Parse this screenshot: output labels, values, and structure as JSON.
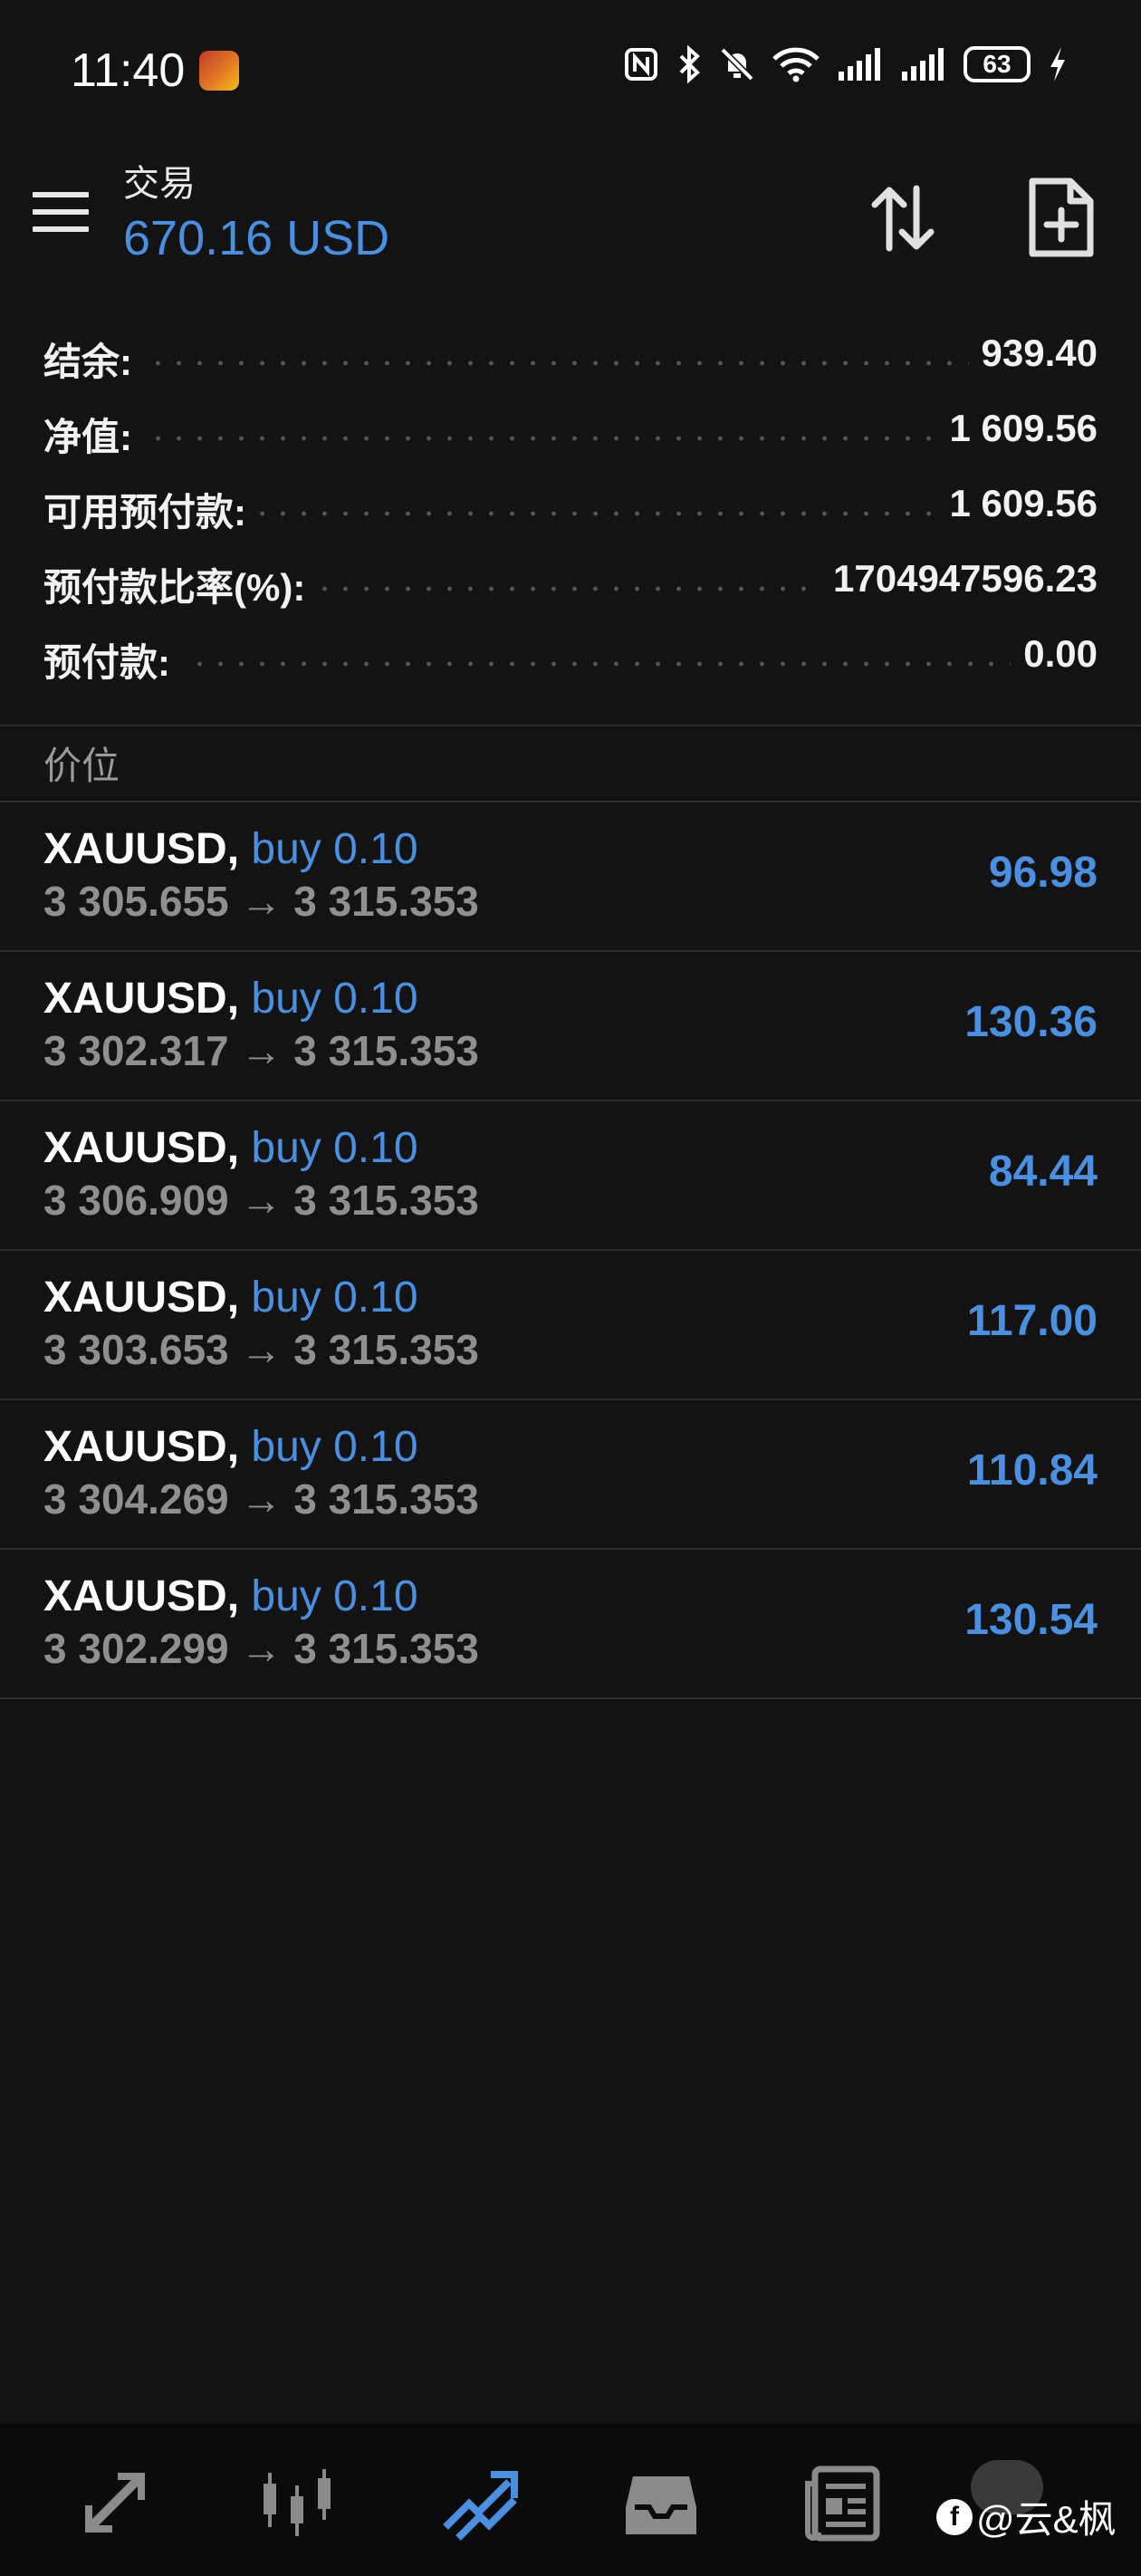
{
  "status_bar": {
    "time": "11:40",
    "battery": "63"
  },
  "header": {
    "title": "交易",
    "balance_display": "670.16 USD"
  },
  "summary": [
    {
      "label": "结余:",
      "value": "939.40"
    },
    {
      "label": "净值:",
      "value": "1 609.56"
    },
    {
      "label": "可用预付款:",
      "value": "1 609.56"
    },
    {
      "label": "预付款比率(%):",
      "value": "1704947596.23"
    },
    {
      "label": "预付款:",
      "value": "0.00"
    }
  ],
  "section_title": "价位",
  "positions": [
    {
      "symbol": "XAUUSD,",
      "side": "buy 0.10",
      "open": "3 305.655",
      "arrow": "→",
      "current": "3 315.353",
      "profit": "96.98"
    },
    {
      "symbol": "XAUUSD,",
      "side": "buy 0.10",
      "open": "3 302.317",
      "arrow": "→",
      "current": "3 315.353",
      "profit": "130.36"
    },
    {
      "symbol": "XAUUSD,",
      "side": "buy 0.10",
      "open": "3 306.909",
      "arrow": "→",
      "current": "3 315.353",
      "profit": "84.44"
    },
    {
      "symbol": "XAUUSD,",
      "side": "buy 0.10",
      "open": "3 303.653",
      "arrow": "→",
      "current": "3 315.353",
      "profit": "117.00"
    },
    {
      "symbol": "XAUUSD,",
      "side": "buy 0.10",
      "open": "3 304.269",
      "arrow": "→",
      "current": "3 315.353",
      "profit": "110.84"
    },
    {
      "symbol": "XAUUSD,",
      "side": "buy 0.10",
      "open": "3 302.299",
      "arrow": "→",
      "current": "3 315.353",
      "profit": "130.54"
    }
  ],
  "bottom_nav": [
    {
      "icon": "quotes-icon",
      "active": false
    },
    {
      "icon": "chart-candles-icon",
      "active": false
    },
    {
      "icon": "trade-icon",
      "active": true
    },
    {
      "icon": "history-inbox-icon",
      "active": false
    },
    {
      "icon": "news-icon",
      "active": false
    }
  ],
  "watermark": {
    "logo": "f",
    "text": "@云&枫"
  },
  "colors": {
    "background": "#131313",
    "accent": "#4a90e2",
    "muted": "#8f8f8f",
    "nav_bg": "#0b0b0b"
  }
}
